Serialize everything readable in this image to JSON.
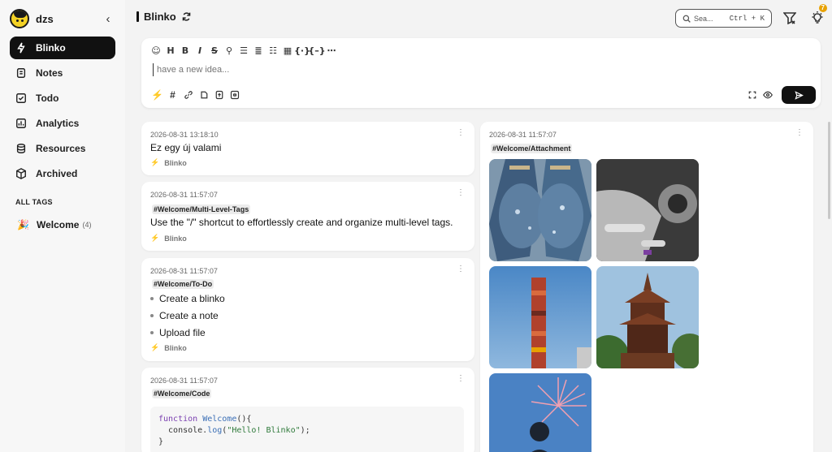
{
  "sidebar": {
    "username": "dzs",
    "collapse_icon": "chevron-left-icon",
    "nav": [
      {
        "label": "Blinko",
        "icon": "bolt-icon",
        "active": true
      },
      {
        "label": "Notes",
        "icon": "notes-icon"
      },
      {
        "label": "Todo",
        "icon": "todo-icon"
      },
      {
        "label": "Analytics",
        "icon": "analytics-icon"
      },
      {
        "label": "Resources",
        "icon": "database-icon"
      },
      {
        "label": "Archived",
        "icon": "box-icon"
      }
    ],
    "tags_title": "ALL TAGS",
    "tags": [
      {
        "emoji": "🎉",
        "name": "Welcome",
        "count": "(4)"
      }
    ]
  },
  "header": {
    "title": "Blinko",
    "search_placeholder": "Sea...",
    "search_shortcut": "Ctrl + K",
    "notification_count": "7"
  },
  "editor": {
    "placeholder": "have a new idea...",
    "toolbar_icons": [
      "emoji-icon",
      "heading-icon",
      "bold-icon",
      "italic-icon",
      "strikethrough-icon",
      "link-icon",
      "bullet-list-icon",
      "numbered-list-icon",
      "check-list-icon",
      "table-icon",
      "code-inline-icon",
      "code-block-icon",
      "more-icon"
    ],
    "tools_icons": [
      "bolt-icon",
      "hashtag-icon",
      "link-icon",
      "attachment-icon",
      "upload-icon",
      "voice-icon"
    ]
  },
  "notes": [
    {
      "date": "2026-08-31 13:18:10",
      "text": "Ez egy új valami",
      "label": "Blinko"
    },
    {
      "date": "2026-08-31 11:57:07",
      "tag": "#Welcome/Multi-Level-Tags",
      "text": "Use the \"/\" shortcut to effortlessly create and organize multi-level tags.",
      "label": "Blinko"
    },
    {
      "date": "2026-08-31 11:57:07",
      "tag": "#Welcome/To-Do",
      "items": [
        "Create a blinko",
        "Create a note",
        "Upload file"
      ],
      "label": "Blinko"
    },
    {
      "date": "2026-08-31 11:57:07",
      "tag": "#Welcome/Code",
      "code_lines": [
        "function Welcome(){",
        "  console.log(\"Hello! Blinko\");",
        "}"
      ]
    },
    {
      "date": "2026-08-31 11:57:07",
      "tag": "#Welcome/Attachment",
      "images": [
        "hands-image",
        "engine-image",
        "tower-image",
        "pagoda-image",
        "fireworks-image"
      ]
    }
  ],
  "colors": {
    "accent": "#111111",
    "bolt": "#e8a200",
    "background": "#f3f3f3"
  }
}
